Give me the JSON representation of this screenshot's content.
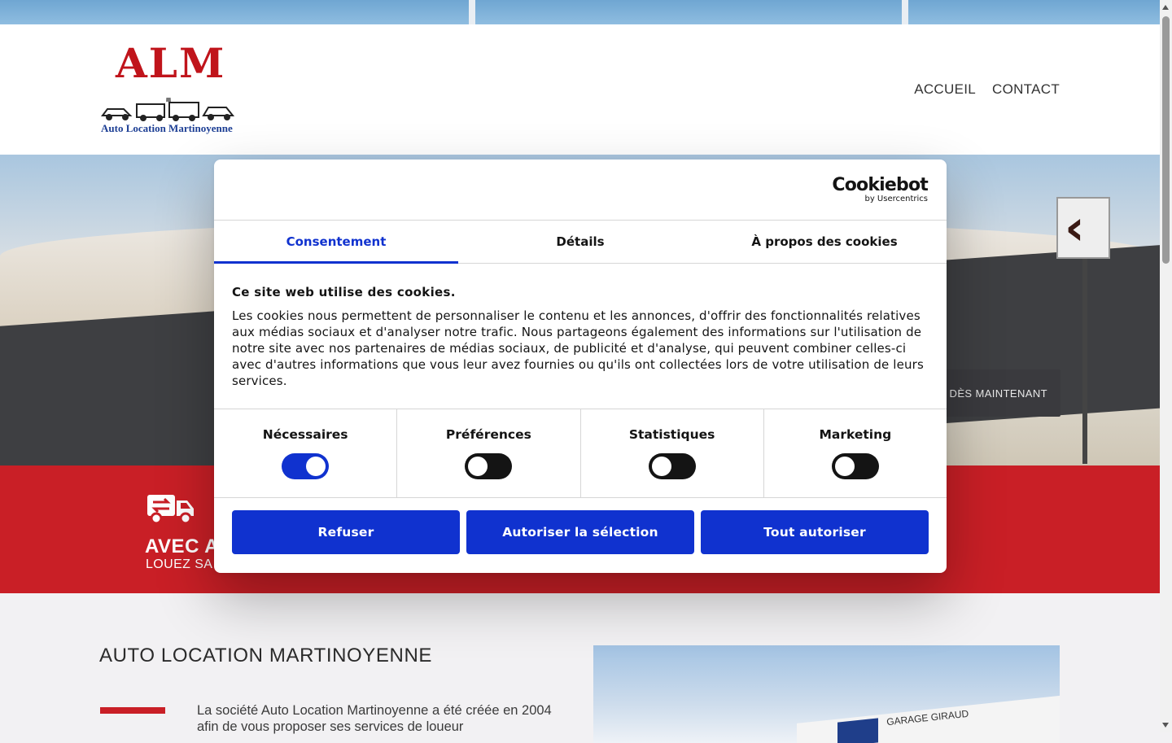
{
  "site": {
    "logo": {
      "letters": "ALM",
      "subtitle": "Auto Location Martinoyenne"
    },
    "nav": [
      {
        "label": "ACCUEIL"
      },
      {
        "label": "CONTACT"
      }
    ],
    "hero_button_partial": "DÈS MAINTENANT",
    "band": {
      "title_partial": "AVEC A",
      "subtitle_partial": "LOUEZ SA"
    },
    "about": {
      "title": "AUTO LOCATION MARTINOYENNE",
      "text": "La société Auto Location Martinoyenne a été créée en 2004 afin de vous proposer ses services de loueur",
      "photo_sign_text": "GARAGE GIRAUD"
    }
  },
  "cookie_dialog": {
    "brand": {
      "name": "Cookiebot",
      "by": "by Usercentrics"
    },
    "tabs": [
      {
        "label": "Consentement",
        "active": true
      },
      {
        "label": "Détails",
        "active": false
      },
      {
        "label": "À propos des cookies",
        "active": false
      }
    ],
    "heading": "Ce site web utilise des cookies.",
    "body": "Les cookies nous permettent de personnaliser le contenu et les annonces, d'offrir des fonctionnalités relatives aux médias sociaux et d'analyser notre trafic. Nous partageons également des informations sur l'utilisation de notre site avec nos partenaires de médias sociaux, de publicité et d'analyse, qui peuvent combiner celles-ci avec d'autres informations que vous leur avez fournies ou qu'ils ont collectées lors de votre utilisation de leurs services.",
    "categories": [
      {
        "label": "Nécessaires",
        "enabled": true
      },
      {
        "label": "Préférences",
        "enabled": false
      },
      {
        "label": "Statistiques",
        "enabled": false
      },
      {
        "label": "Marketing",
        "enabled": false
      }
    ],
    "buttons": {
      "refuse": "Refuser",
      "allow_selection": "Autoriser la sélection",
      "allow_all": "Tout autoriser"
    }
  },
  "colors": {
    "accent": "#1032cf",
    "brand_red": "#c91f26",
    "logo_blue": "#1c3e94"
  }
}
